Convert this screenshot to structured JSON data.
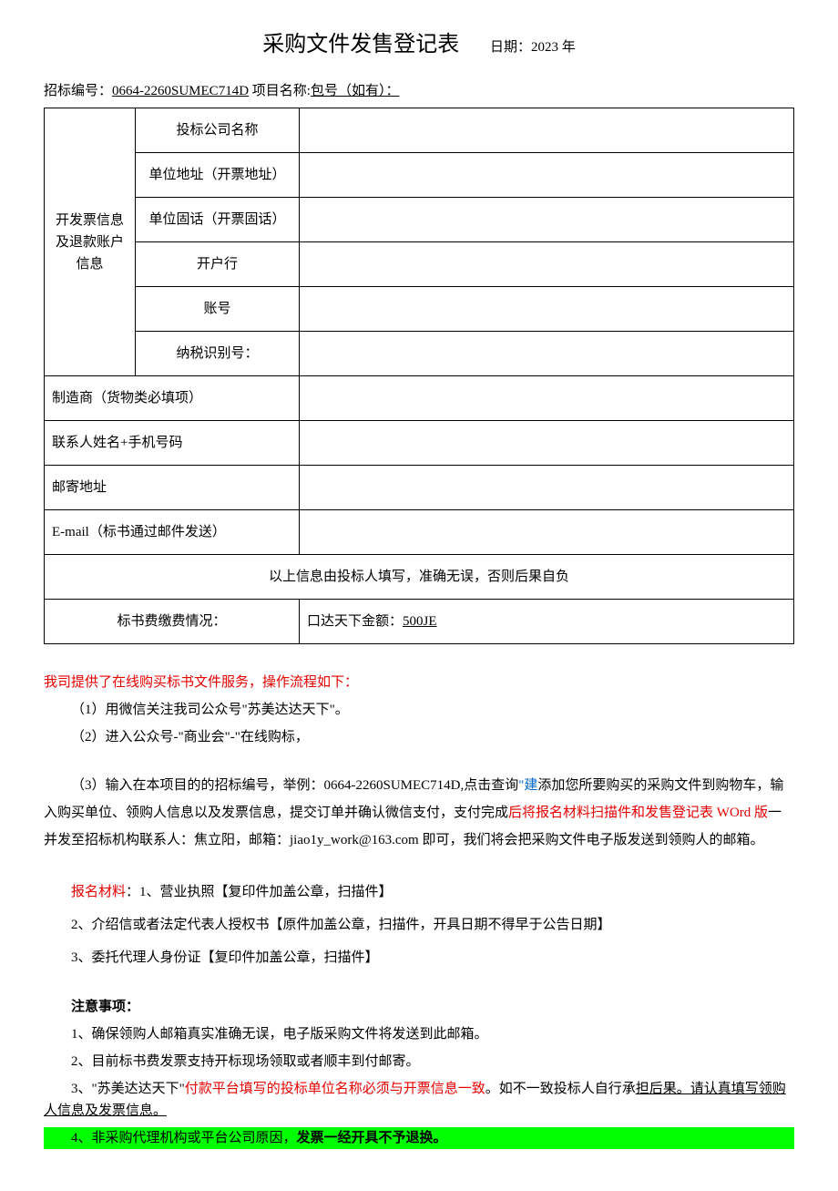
{
  "title": "采购文件发售登记表",
  "date_label": "日期：2023 年",
  "header": {
    "bid_no_label": "招标编号：",
    "bid_no": "0664-2260SUMEC714D",
    "project_label": " 项目名称:",
    "package_label": "包号（如有）：",
    "package_value": "  "
  },
  "table": {
    "section_invoice": "开发票信息及退款账户信息",
    "rows": {
      "company": "投标公司名称",
      "address": "单位地址（开票地址）",
      "phone": "单位固话（开票固话）",
      "bank": "开户行",
      "account": "账号",
      "tax_id": "纳税识别号："
    },
    "manufacturer": "制造商（货物类必填项）",
    "contact": "联系人姓名+手机号码",
    "mail_addr": "邮寄地址",
    "email": "E-mail（标书通过邮件发送）",
    "confirm_note": "以上信息由投标人填写，准确无误，否则后果自负",
    "fee_label": "标书费缴费情况：",
    "fee_checkbox": "口达天下金额：",
    "fee_amount": "500JE"
  },
  "instructions": {
    "intro": "我司提供了在线购买标书文件服务，操作流程如下：",
    "step1": "（1）用微信关注我司公众号\"苏美达达天下\"。",
    "step2": "（2）进入公众号-\"商业会\"-\"在线购标，",
    "step3_a": "（3）输入在本项目的的招标编号，举例：0664-2260SUMEC714D,点击查询",
    "step3_b": "\"建",
    "step3_c": "添加您所要购买的采购文件到购物车，输入购买单位、领购人信息以及发票信息，提交订单并确认微信支付，支付完成",
    "step3_d": "后将报",
    "step3_e": "名材料扫描件和发售登记表 WOrd 版",
    "step3_f": "一并发至招标机构联系人：焦立阳，邮箱：jiao1y_work@163.com 即可，我们将会把采购文件电子版发送到领购人的邮箱。"
  },
  "materials": {
    "label": "报名材料",
    "item1": "：1、营业执照【复印件加盖公章，扫描件】",
    "item2": "2、介绍信或者法定代表人授权书【原件加盖公章，扫描件，开具日期不得早于公告日期】",
    "item3": "3、委托代理人身份证【复印件加盖公章，扫描件】"
  },
  "notices": {
    "title": "注意事项：",
    "n1": "1、确保领购人邮箱真实准确无误，电子版采购文件将发送到此邮箱。",
    "n2": "2、目前标书费发票支持开标现场领取或者顺丰到付邮寄。",
    "n3_a": "3、\"苏美达达天下\"",
    "n3_b": "付款平台填写的投标单位名称必须与开票信息一致",
    "n3_c": "。如不一致投标人自行承",
    "n3_d": "担后果。请认真填写领购人信息及发票信息。",
    "n4_a": "4、非采购代理机构或平台公司原因，",
    "n4_b": "发票一经开具不予退换。"
  }
}
